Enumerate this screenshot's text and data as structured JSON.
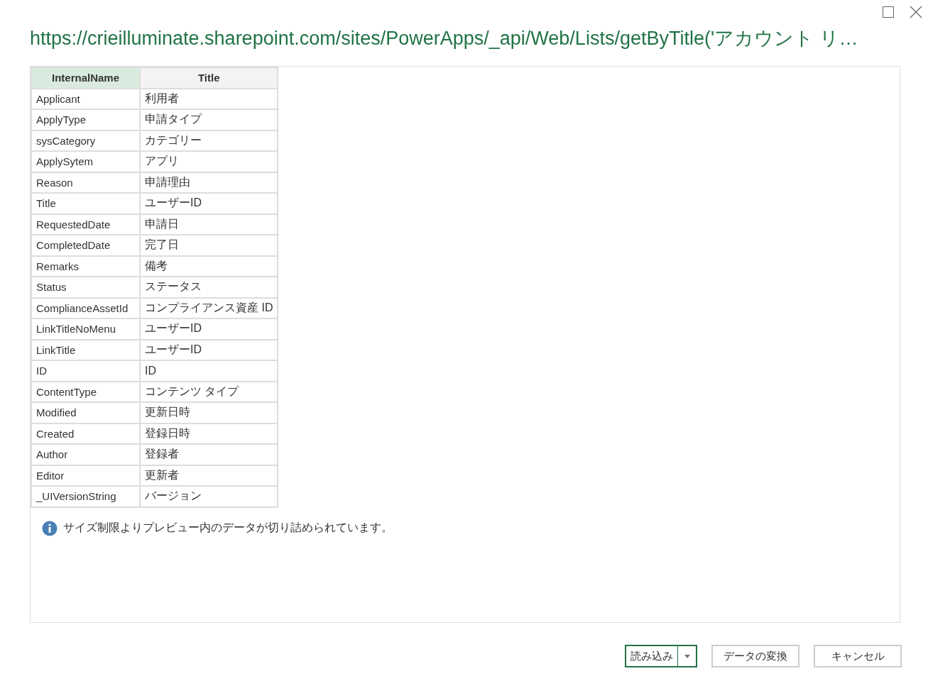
{
  "window": {
    "title": "https://crieilluminate.sharepoint.com/sites/PowerApps/_api/Web/Lists/getByTitle('アカウント リ…"
  },
  "table": {
    "columns": [
      {
        "label": "InternalName",
        "selected": true
      },
      {
        "label": "Title",
        "selected": false
      }
    ],
    "rows": [
      [
        "Applicant",
        "利用者"
      ],
      [
        "ApplyType",
        "申請タイプ"
      ],
      [
        "sysCategory",
        "カテゴリー"
      ],
      [
        "ApplySytem",
        "アプリ"
      ],
      [
        "Reason",
        "申請理由"
      ],
      [
        "Title",
        "ユーザーID"
      ],
      [
        "RequestedDate",
        "申請日"
      ],
      [
        "CompletedDate",
        "完了日"
      ],
      [
        "Remarks",
        "備考"
      ],
      [
        "Status",
        "ステータス"
      ],
      [
        "ComplianceAssetId",
        "コンプライアンス資産 ID"
      ],
      [
        "LinkTitleNoMenu",
        "ユーザーID"
      ],
      [
        "LinkTitle",
        "ユーザーID"
      ],
      [
        "ID",
        "ID"
      ],
      [
        "ContentType",
        "コンテンツ タイプ"
      ],
      [
        "Modified",
        "更新日時"
      ],
      [
        "Created",
        "登録日時"
      ],
      [
        "Author",
        "登録者"
      ],
      [
        "Editor",
        "更新者"
      ],
      [
        "_UIVersionString",
        "バージョン"
      ]
    ]
  },
  "notice": "サイズ制限よりプレビュー内のデータが切り詰められています。",
  "buttons": {
    "load": "読み込み",
    "transform": "データの変換",
    "cancel": "キャンセル"
  }
}
